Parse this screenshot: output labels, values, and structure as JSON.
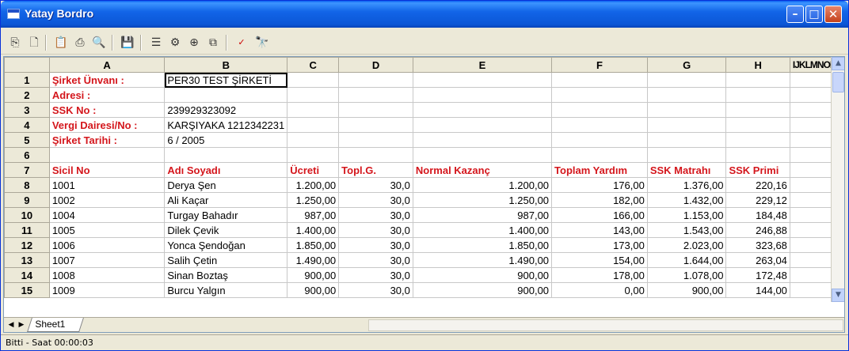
{
  "window": {
    "title": "Yatay Bordro"
  },
  "toolbar": {
    "icons": [
      "copy-icon",
      "page-icon",
      "paste-icon",
      "print-icon",
      "print-preview-icon",
      "save-icon",
      "list-icon",
      "properties-icon",
      "zoom-icon",
      "export-icon",
      "spell-check-icon",
      "find-icon"
    ]
  },
  "sheet": {
    "columns": [
      "A",
      "B",
      "C",
      "D",
      "E",
      "F",
      "G",
      "H",
      "I",
      "J",
      "K",
      "L",
      "M",
      "N",
      "O",
      "P"
    ],
    "narrow_columns_label": "IJKLMNOP",
    "row_numbers": [
      "1",
      "2",
      "3",
      "4",
      "5",
      "6",
      "7",
      "8",
      "9",
      "10",
      "11",
      "12",
      "13",
      "14",
      "15"
    ],
    "company_info": [
      {
        "label": "Şirket Ünvanı :",
        "value": "PER30 TEST ŞİRKETİ"
      },
      {
        "label": "Adresi :",
        "value": ""
      },
      {
        "label": "SSK No :",
        "value": "239929323092"
      },
      {
        "label": "Vergi Dairesi/No :",
        "value": "KARŞIYAKA 1212342231"
      },
      {
        "label": "Şirket Tarihi :",
        "value": "6 / 2005"
      }
    ],
    "table_headers": [
      "Sicil No",
      "Adı Soyadı",
      "Ücreti",
      "Topl.G.",
      "Normal Kazanç",
      "Toplam Yardım",
      "SSK Matrahı",
      "SSK Primi"
    ],
    "rows": [
      [
        "1001",
        "Derya Şen",
        "1.200,00",
        "30,0",
        "1.200,00",
        "176,00",
        "1.376,00",
        "220,16"
      ],
      [
        "1002",
        "Ali Kaçar",
        "1.250,00",
        "30,0",
        "1.250,00",
        "182,00",
        "1.432,00",
        "229,12"
      ],
      [
        "1004",
        "Turgay Bahadır",
        "987,00",
        "30,0",
        "987,00",
        "166,00",
        "1.153,00",
        "184,48"
      ],
      [
        "1005",
        "Dilek Çevik",
        "1.400,00",
        "30,0",
        "1.400,00",
        "143,00",
        "1.543,00",
        "246,88"
      ],
      [
        "1006",
        "Yonca Şendoğan",
        "1.850,00",
        "30,0",
        "1.850,00",
        "173,00",
        "2.023,00",
        "323,68"
      ],
      [
        "1007",
        "Salih Çetin",
        "1.490,00",
        "30,0",
        "1.490,00",
        "154,00",
        "1.644,00",
        "263,04"
      ],
      [
        "1008",
        "Sinan Boztaş",
        "900,00",
        "30,0",
        "900,00",
        "178,00",
        "1.078,00",
        "172,48"
      ],
      [
        "1009",
        "Burcu Yalgın",
        "900,00",
        "30,0",
        "900,00",
        "0,00",
        "900,00",
        "144,00"
      ]
    ],
    "tab_name": "Sheet1"
  },
  "status": {
    "text": "Bitti  -  Saat 00:00:03"
  }
}
